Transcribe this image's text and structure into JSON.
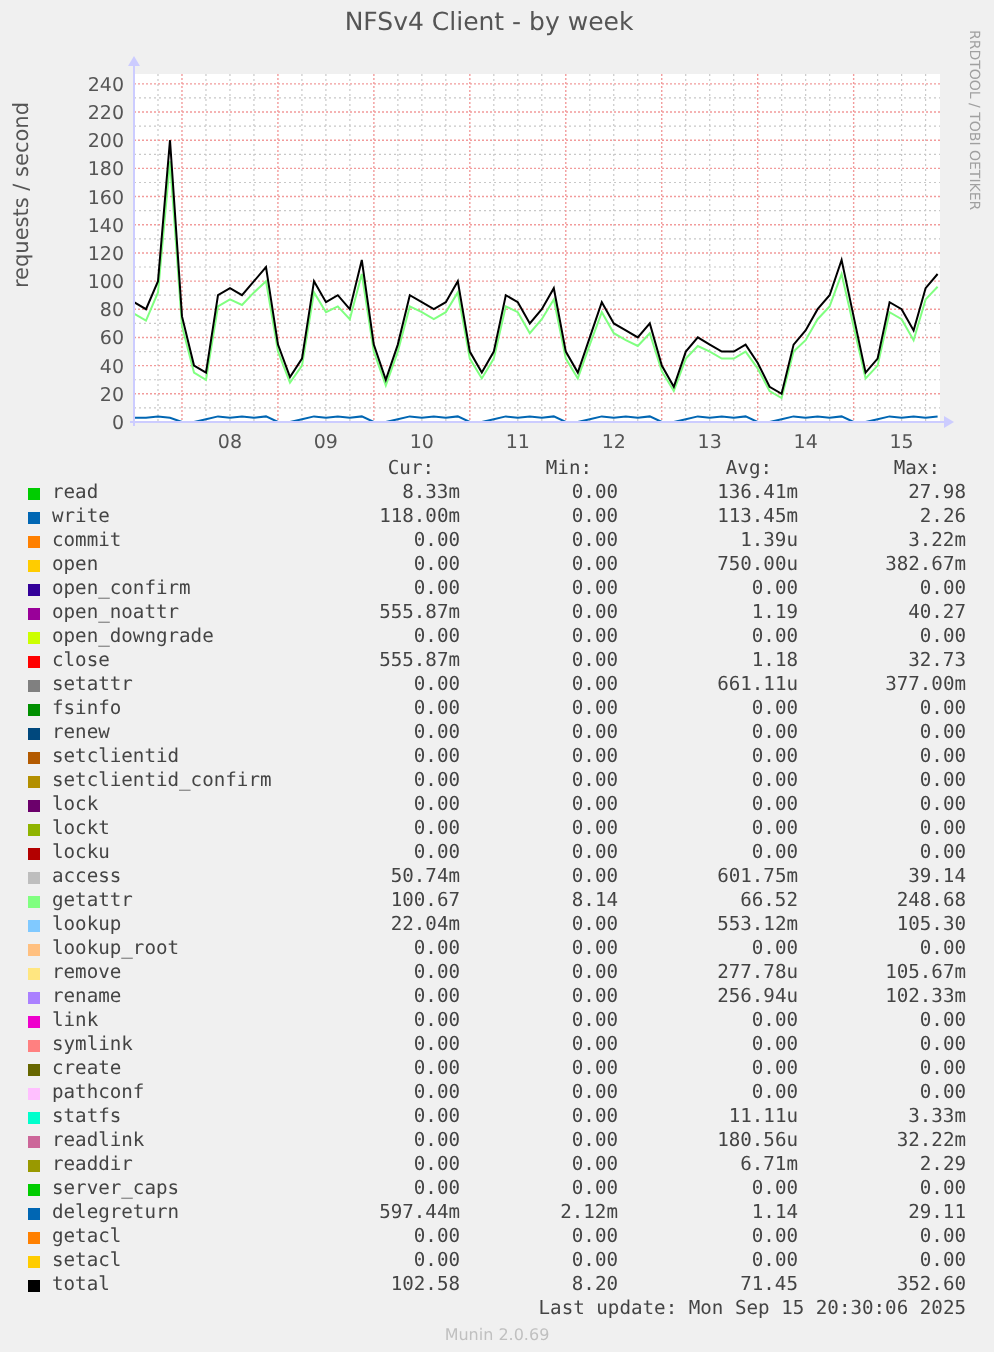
{
  "title": "NFSv4 Client - by week",
  "side_credit": "RRDTOOL / TOBI OETIKER",
  "graph": {
    "chart_data": {
      "type": "line",
      "ylabel": "requests / second",
      "x": [
        7.5,
        7.625,
        7.75,
        7.875,
        8,
        8.125,
        8.25,
        8.375,
        8.5,
        8.625,
        8.75,
        8.875,
        9,
        9.125,
        9.25,
        9.375,
        9.5,
        9.625,
        9.75,
        9.875,
        10,
        10.125,
        10.25,
        10.375,
        10.5,
        10.625,
        10.75,
        10.875,
        11,
        11.125,
        11.25,
        11.375,
        11.5,
        11.625,
        11.75,
        11.875,
        12,
        12.125,
        12.25,
        12.375,
        12.5,
        12.625,
        12.75,
        12.875,
        13,
        13.125,
        13.25,
        13.375,
        13.5,
        13.625,
        13.75,
        13.875,
        14,
        14.125,
        14.25,
        14.375,
        14.5,
        14.625,
        14.75,
        14.875,
        15,
        15.125,
        15.25,
        15.375,
        15.5,
        15.625,
        15.75,
        15.875
      ],
      "series": [
        {
          "color": "#80ff80",
          "values": [
            77,
            72,
            92,
            185,
            68,
            35,
            30,
            82,
            87,
            83,
            92,
            100,
            50,
            28,
            40,
            92,
            78,
            82,
            73,
            105,
            50,
            26,
            50,
            82,
            78,
            73,
            78,
            92,
            45,
            31,
            45,
            82,
            78,
            63,
            73,
            87,
            45,
            31,
            55,
            78,
            63,
            58,
            54,
            63,
            36,
            22,
            45,
            54,
            50,
            45,
            45,
            50,
            38,
            22,
            17,
            50,
            58,
            73,
            82,
            105,
            68,
            31,
            40,
            78,
            73,
            58,
            87,
            96
          ]
        },
        {
          "color": "#0066b3",
          "values": [
            3,
            3,
            4,
            3,
            0,
            0,
            2,
            4,
            3,
            4,
            3,
            4,
            0,
            0,
            2,
            4,
            3,
            4,
            3,
            4,
            0,
            0,
            2,
            4,
            3,
            4,
            3,
            4,
            0,
            0,
            2,
            4,
            3,
            4,
            3,
            4,
            0,
            0,
            2,
            4,
            3,
            4,
            3,
            4,
            0,
            0,
            2,
            4,
            3,
            4,
            3,
            4,
            0,
            0,
            2,
            4,
            3,
            4,
            3,
            4,
            0,
            0,
            2,
            4,
            3,
            4,
            3,
            4
          ]
        },
        {
          "color": "#000000",
          "values": [
            85,
            80,
            100,
            200,
            75,
            40,
            35,
            90,
            95,
            90,
            100,
            110,
            55,
            32,
            45,
            100,
            85,
            90,
            80,
            115,
            55,
            30,
            55,
            90,
            85,
            80,
            85,
            100,
            50,
            35,
            50,
            90,
            85,
            70,
            80,
            95,
            50,
            35,
            60,
            85,
            70,
            65,
            60,
            70,
            40,
            25,
            50,
            60,
            55,
            50,
            50,
            55,
            42,
            25,
            20,
            55,
            65,
            80,
            90,
            115,
            75,
            35,
            45,
            85,
            80,
            65,
            95,
            105
          ]
        }
      ],
      "xlim": [
        7.5,
        15.9
      ],
      "ylim": [
        0,
        247
      ],
      "grid": true,
      "xticks": [
        {
          "value": 8.5,
          "label": "08"
        },
        {
          "value": 9.5,
          "label": "09"
        },
        {
          "value": 10.5,
          "label": "10"
        },
        {
          "value": 11.5,
          "label": "11"
        },
        {
          "value": 12.5,
          "label": "12"
        },
        {
          "value": 13.5,
          "label": "13"
        },
        {
          "value": 14.5,
          "label": "14"
        },
        {
          "value": 15.5,
          "label": "15"
        }
      ],
      "yticks": [
        0,
        20,
        40,
        60,
        80,
        100,
        120,
        140,
        160,
        180,
        200,
        220,
        240
      ]
    }
  },
  "legend": {
    "columns": [
      "Cur:",
      "Min:",
      "Avg:",
      "Max:"
    ],
    "rows": [
      {
        "name": "read",
        "color": "#00cc00",
        "cur": "8.33m",
        "min": "0.00",
        "avg": "136.41m",
        "max": "27.98"
      },
      {
        "name": "write",
        "color": "#0066b3",
        "cur": "118.00m",
        "min": "0.00",
        "avg": "113.45m",
        "max": "2.26"
      },
      {
        "name": "commit",
        "color": "#ff8000",
        "cur": "0.00",
        "min": "0.00",
        "avg": "1.39u",
        "max": "3.22m"
      },
      {
        "name": "open",
        "color": "#ffcc00",
        "cur": "0.00",
        "min": "0.00",
        "avg": "750.00u",
        "max": "382.67m"
      },
      {
        "name": "open_confirm",
        "color": "#330099",
        "cur": "0.00",
        "min": "0.00",
        "avg": "0.00",
        "max": "0.00"
      },
      {
        "name": "open_noattr",
        "color": "#990099",
        "cur": "555.87m",
        "min": "0.00",
        "avg": "1.19",
        "max": "40.27"
      },
      {
        "name": "open_downgrade",
        "color": "#ccff00",
        "cur": "0.00",
        "min": "0.00",
        "avg": "0.00",
        "max": "0.00"
      },
      {
        "name": "close",
        "color": "#ff0000",
        "cur": "555.87m",
        "min": "0.00",
        "avg": "1.18",
        "max": "32.73"
      },
      {
        "name": "setattr",
        "color": "#808080",
        "cur": "0.00",
        "min": "0.00",
        "avg": "661.11u",
        "max": "377.00m"
      },
      {
        "name": "fsinfo",
        "color": "#008f00",
        "cur": "0.00",
        "min": "0.00",
        "avg": "0.00",
        "max": "0.00"
      },
      {
        "name": "renew",
        "color": "#00487d",
        "cur": "0.00",
        "min": "0.00",
        "avg": "0.00",
        "max": "0.00"
      },
      {
        "name": "setclientid",
        "color": "#b35a00",
        "cur": "0.00",
        "min": "0.00",
        "avg": "0.00",
        "max": "0.00"
      },
      {
        "name": "setclientid_confirm",
        "color": "#b38f00",
        "cur": "0.00",
        "min": "0.00",
        "avg": "0.00",
        "max": "0.00"
      },
      {
        "name": "lock",
        "color": "#6b006b",
        "cur": "0.00",
        "min": "0.00",
        "avg": "0.00",
        "max": "0.00"
      },
      {
        "name": "lockt",
        "color": "#8fb300",
        "cur": "0.00",
        "min": "0.00",
        "avg": "0.00",
        "max": "0.00"
      },
      {
        "name": "locku",
        "color": "#b30000",
        "cur": "0.00",
        "min": "0.00",
        "avg": "0.00",
        "max": "0.00"
      },
      {
        "name": "access",
        "color": "#bebebe",
        "cur": "50.74m",
        "min": "0.00",
        "avg": "601.75m",
        "max": "39.14"
      },
      {
        "name": "getattr",
        "color": "#80ff80",
        "cur": "100.67",
        "min": "8.14",
        "avg": "66.52",
        "max": "248.68"
      },
      {
        "name": "lookup",
        "color": "#80c9ff",
        "cur": "22.04m",
        "min": "0.00",
        "avg": "553.12m",
        "max": "105.30"
      },
      {
        "name": "lookup_root",
        "color": "#ffc080",
        "cur": "0.00",
        "min": "0.00",
        "avg": "0.00",
        "max": "0.00"
      },
      {
        "name": "remove",
        "color": "#ffe680",
        "cur": "0.00",
        "min": "0.00",
        "avg": "277.78u",
        "max": "105.67m"
      },
      {
        "name": "rename",
        "color": "#aa80ff",
        "cur": "0.00",
        "min": "0.00",
        "avg": "256.94u",
        "max": "102.33m"
      },
      {
        "name": "link",
        "color": "#ee00cc",
        "cur": "0.00",
        "min": "0.00",
        "avg": "0.00",
        "max": "0.00"
      },
      {
        "name": "symlink",
        "color": "#ff8080",
        "cur": "0.00",
        "min": "0.00",
        "avg": "0.00",
        "max": "0.00"
      },
      {
        "name": "create",
        "color": "#666600",
        "cur": "0.00",
        "min": "0.00",
        "avg": "0.00",
        "max": "0.00"
      },
      {
        "name": "pathconf",
        "color": "#ffbfff",
        "cur": "0.00",
        "min": "0.00",
        "avg": "0.00",
        "max": "0.00"
      },
      {
        "name": "statfs",
        "color": "#00ffcc",
        "cur": "0.00",
        "min": "0.00",
        "avg": "11.11u",
        "max": "3.33m"
      },
      {
        "name": "readlink",
        "color": "#cc6699",
        "cur": "0.00",
        "min": "0.00",
        "avg": "180.56u",
        "max": "32.22m"
      },
      {
        "name": "readdir",
        "color": "#999900",
        "cur": "0.00",
        "min": "0.00",
        "avg": "6.71m",
        "max": "2.29"
      },
      {
        "name": "server_caps",
        "color": "#00cc00",
        "cur": "0.00",
        "min": "0.00",
        "avg": "0.00",
        "max": "0.00"
      },
      {
        "name": "delegreturn",
        "color": "#0066b3",
        "cur": "597.44m",
        "min": "2.12m",
        "avg": "1.14",
        "max": "29.11"
      },
      {
        "name": "getacl",
        "color": "#ff8000",
        "cur": "0.00",
        "min": "0.00",
        "avg": "0.00",
        "max": "0.00"
      },
      {
        "name": "setacl",
        "color": "#ffcc00",
        "cur": "0.00",
        "min": "0.00",
        "avg": "0.00",
        "max": "0.00"
      },
      {
        "name": "total",
        "color": "#000000",
        "cur": "102.58",
        "min": "8.20",
        "avg": "71.45",
        "max": "352.60"
      }
    ]
  },
  "last_update": "Last update: Mon Sep 15 20:30:06 2025",
  "footer": "Munin 2.0.69"
}
